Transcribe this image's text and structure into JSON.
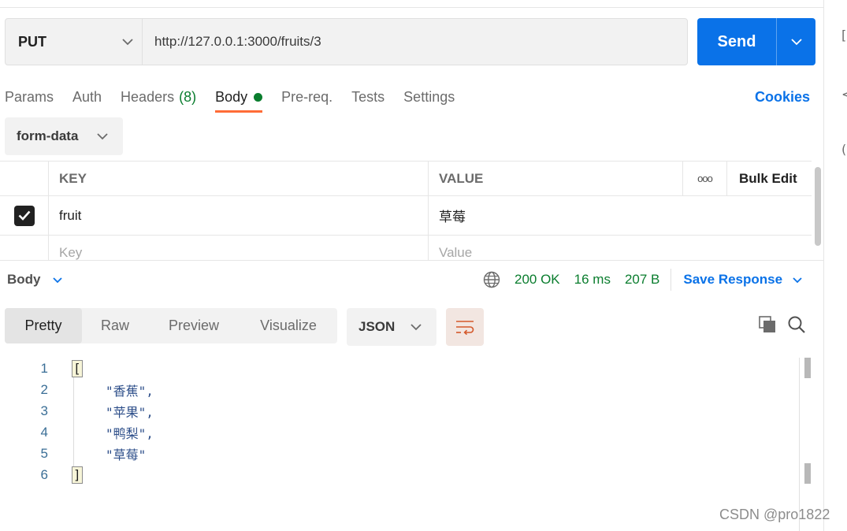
{
  "request": {
    "method": "PUT",
    "url": "http://127.0.0.1:3000/fruits/3",
    "send_label": "Send"
  },
  "request_tabs": {
    "params": "Params",
    "auth": "Auth",
    "headers": "Headers",
    "headers_count": "(8)",
    "body": "Body",
    "prereq": "Pre-req.",
    "tests": "Tests",
    "settings": "Settings",
    "cookies": "Cookies"
  },
  "body_type": "form-data",
  "kv_table": {
    "header_key": "KEY",
    "header_value": "VALUE",
    "header_dots": "ooo",
    "bulk_edit": "Bulk Edit",
    "rows": [
      {
        "checked": true,
        "key": "fruit",
        "value": "草莓"
      }
    ],
    "key_placeholder": "Key",
    "value_placeholder": "Value"
  },
  "response": {
    "section_label": "Body",
    "status": "200 OK",
    "time": "16 ms",
    "size": "207 B",
    "save_label": "Save Response",
    "view_tabs": [
      "Pretty",
      "Raw",
      "Preview",
      "Visualize"
    ],
    "active_view": "Pretty",
    "format": "JSON",
    "lines": [
      {
        "n": "1",
        "text": "["
      },
      {
        "n": "2",
        "text": "\"香蕉\","
      },
      {
        "n": "3",
        "text": "\"苹果\","
      },
      {
        "n": "4",
        "text": "\"鸭梨\","
      },
      {
        "n": "5",
        "text": "\"草莓\""
      },
      {
        "n": "6",
        "text": "]"
      }
    ]
  },
  "right_panel_glyphs": [
    "[",
    "<",
    "("
  ],
  "watermark": "CSDN @pro1822",
  "colors": {
    "accent_blue": "#0a72e8",
    "status_green": "#0a7d2e",
    "tab_underline": "#ff6c37"
  }
}
